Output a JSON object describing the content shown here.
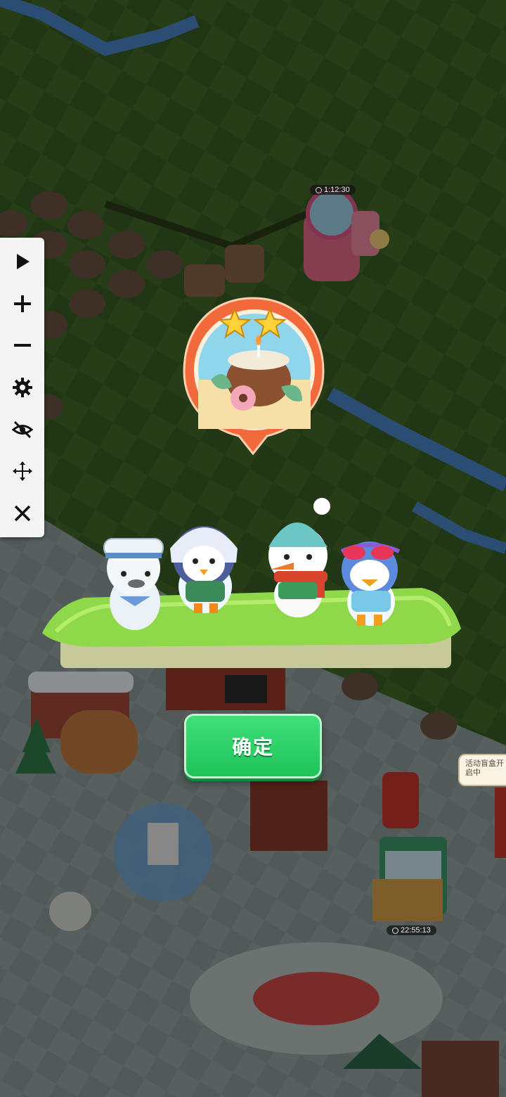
{
  "toolbar": {
    "items": [
      {
        "name": "play-icon"
      },
      {
        "name": "plus-icon"
      },
      {
        "name": "minus-icon"
      },
      {
        "name": "gear-icon"
      },
      {
        "name": "eye-off-icon"
      },
      {
        "name": "move-icon"
      },
      {
        "name": "close-icon"
      }
    ]
  },
  "reward": {
    "stars": 2,
    "item_icon": "coconut-candle-icon",
    "characters": [
      "sailor-seal",
      "beanie-penguin",
      "snowman",
      "sunglasses-penguin"
    ]
  },
  "confirm_button": {
    "label": "确定"
  },
  "timers": {
    "top_timer": "1:12:30",
    "bottom_timer": "22:55:13"
  },
  "event_note": {
    "text": "活动盲盒开启中"
  },
  "colors": {
    "grass_dark": "#2c4a1c",
    "grass_light": "#3d6226",
    "plaza": "#6a7a78",
    "confirm_green": "#27c95f",
    "badge_orange": "#f26a3c",
    "overlay": "rgba(0,0,0,0.45)"
  }
}
